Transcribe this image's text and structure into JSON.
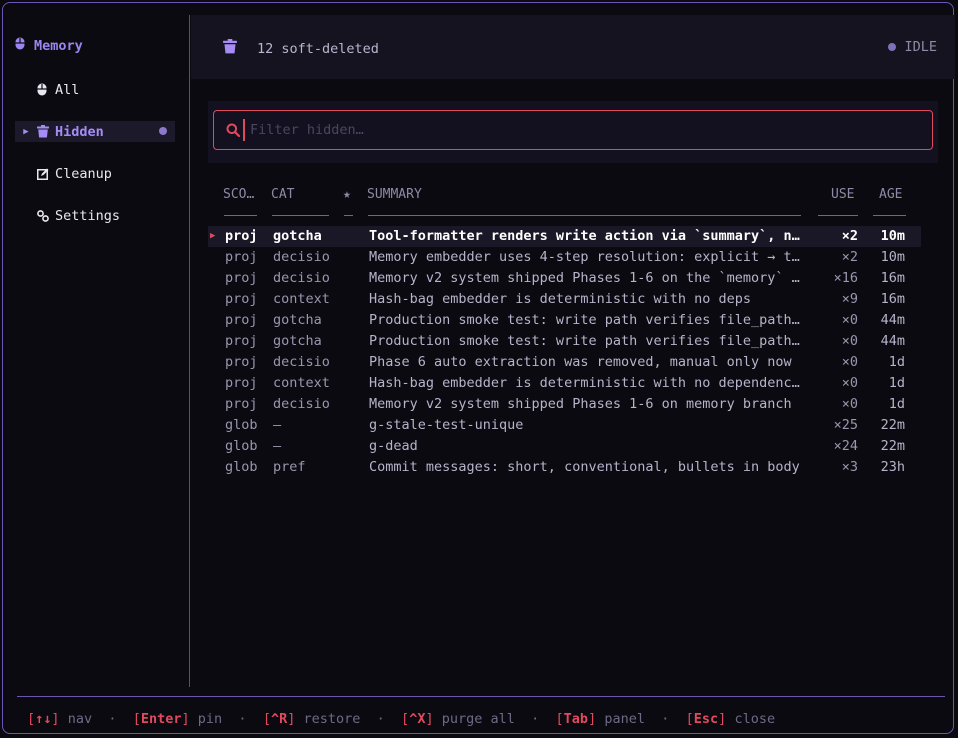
{
  "sidebar": {
    "title": "Memory",
    "items": [
      {
        "label": "All",
        "icon": "brain-icon"
      },
      {
        "label": "Hidden",
        "icon": "trash-icon"
      },
      {
        "label": "Cleanup",
        "icon": "edit-icon"
      },
      {
        "label": "Settings",
        "icon": "settings-icon"
      }
    ]
  },
  "header": {
    "title": "12 soft-deleted",
    "status": "IDLE"
  },
  "search": {
    "placeholder": "Filter hidden…",
    "value": ""
  },
  "table": {
    "columns": {
      "scope": "SCO…",
      "cat": "CAT",
      "star": "★",
      "summary": "SUMMARY",
      "use": "USE",
      "age": "AGE"
    },
    "rows": [
      {
        "scope": "proj",
        "cat": "gotcha",
        "summary": "Tool-formatter renders write action via `summary`, no…",
        "use": "×2",
        "age": "10m"
      },
      {
        "scope": "proj",
        "cat": "decisio",
        "summary": "Memory embedder uses 4-step resolution: explicit → ta…",
        "use": "×2",
        "age": "10m"
      },
      {
        "scope": "proj",
        "cat": "decisio",
        "summary": "Memory v2 system shipped Phases 1-6 on the `memory` b…",
        "use": "×16",
        "age": "16m"
      },
      {
        "scope": "proj",
        "cat": "context",
        "summary": "Hash-bag embedder is deterministic with no deps",
        "use": "×9",
        "age": "16m"
      },
      {
        "scope": "proj",
        "cat": "gotcha",
        "summary": "Production smoke test: write path verifies file_paths…",
        "use": "×0",
        "age": "44m"
      },
      {
        "scope": "proj",
        "cat": "gotcha",
        "summary": "Production smoke test: write path verifies file_paths…",
        "use": "×0",
        "age": "44m"
      },
      {
        "scope": "proj",
        "cat": "decisio",
        "summary": "Phase 6 auto extraction was removed, manual only now",
        "use": "×0",
        "age": "1d"
      },
      {
        "scope": "proj",
        "cat": "context",
        "summary": "Hash-bag embedder is deterministic with no dependenci…",
        "use": "×0",
        "age": "1d"
      },
      {
        "scope": "proj",
        "cat": "decisio",
        "summary": "Memory v2 system shipped Phases 1-6 on memory branch",
        "use": "×0",
        "age": "1d"
      },
      {
        "scope": "glob",
        "cat": "—",
        "summary": "g-stale-test-unique",
        "use": "×25",
        "age": "22m"
      },
      {
        "scope": "glob",
        "cat": "—",
        "summary": "g-dead",
        "use": "×24",
        "age": "22m"
      },
      {
        "scope": "glob",
        "cat": "pref",
        "summary": "Commit messages: short, conventional, bullets in body",
        "use": "×3",
        "age": "23h"
      }
    ]
  },
  "footer": {
    "nav_key": "↑↓",
    "nav": "nav",
    "pin_key": "Enter",
    "pin": "pin",
    "restore_key": "^R",
    "restore": "restore",
    "purge_key": "^X",
    "purge": "purge all",
    "panel_key": "Tab",
    "panel": "panel",
    "close_key": "Esc",
    "close": "close"
  },
  "colors": {
    "accent": "#a58cf5",
    "danger": "#e04a5e",
    "border": "#6c55b8",
    "background": "#0b0a10"
  }
}
